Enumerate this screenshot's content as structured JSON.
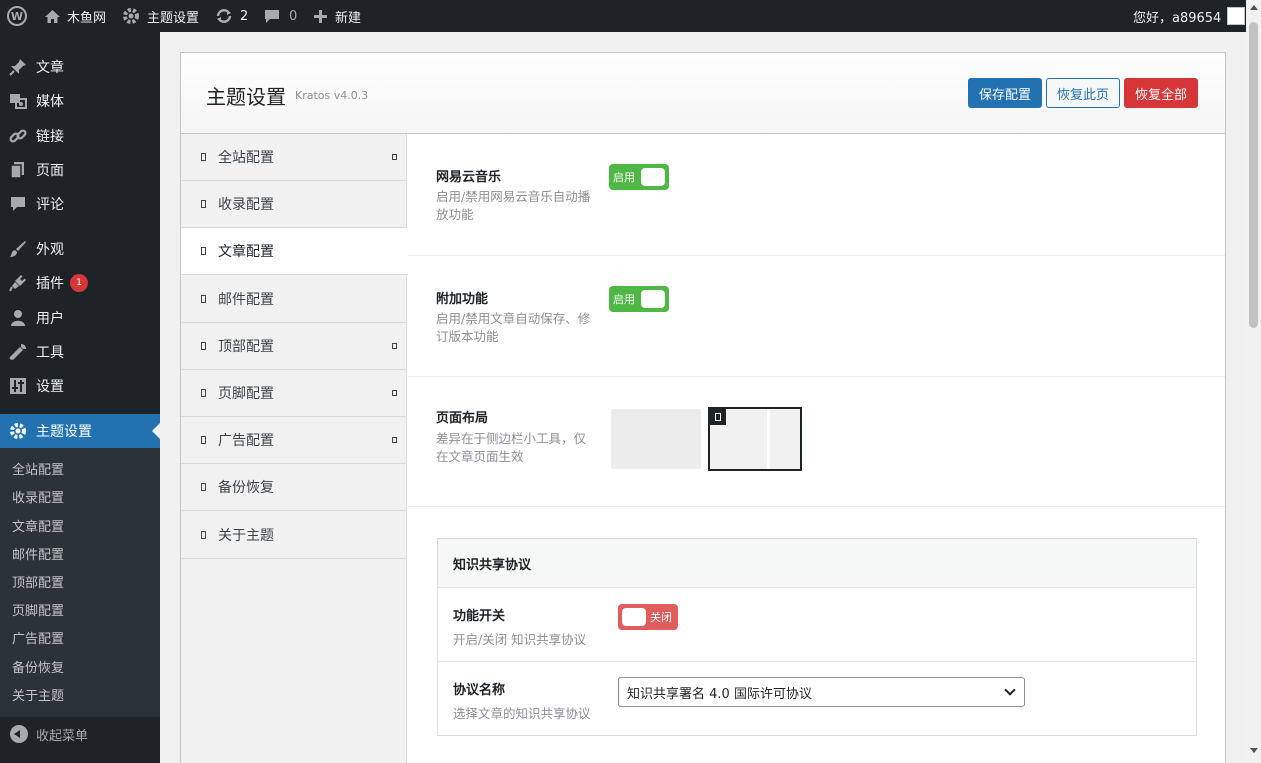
{
  "admin_bar": {
    "site_name": "木鱼网",
    "theme_settings": "主题设置",
    "updates_count": "2",
    "comments_count": "0",
    "new_label": "新建",
    "greeting": "您好，a89654"
  },
  "admin_menu": {
    "items": [
      {
        "label": "文章",
        "icon": "pin-icon"
      },
      {
        "label": "媒体",
        "icon": "media-icon"
      },
      {
        "label": "链接",
        "icon": "link-icon"
      },
      {
        "label": "页面",
        "icon": "page-icon"
      },
      {
        "label": "评论",
        "icon": "comment-icon"
      },
      {
        "label": "外观",
        "icon": "brush-icon"
      },
      {
        "label": "插件",
        "icon": "plugin-icon",
        "badge": "1"
      },
      {
        "label": "用户",
        "icon": "user-icon"
      },
      {
        "label": "工具",
        "icon": "wrench-icon"
      },
      {
        "label": "设置",
        "icon": "settings-icon"
      },
      {
        "label": "主题设置",
        "icon": "gear-icon"
      }
    ],
    "submenu": [
      "全站配置",
      "收录配置",
      "文章配置",
      "邮件配置",
      "顶部配置",
      "页脚配置",
      "广告配置",
      "备份恢复",
      "关于主题"
    ],
    "collapse_label": "收起菜单"
  },
  "panel": {
    "title": "主题设置",
    "version": "Kratos v4.0.3",
    "buttons": {
      "save": "保存配置",
      "restore_page": "恢复此页",
      "restore_all": "恢复全部"
    }
  },
  "panel_nav": {
    "items": [
      "全站配置",
      "收录配置",
      "文章配置",
      "邮件配置",
      "顶部配置",
      "页脚配置",
      "广告配置",
      "备份恢复",
      "关于主题"
    ],
    "active": "文章配置"
  },
  "fields": {
    "music": {
      "title": "网易云音乐",
      "desc": "启用/禁用网易云音乐自动播放功能",
      "toggle": "启用"
    },
    "extra": {
      "title": "附加功能",
      "desc": "启用/禁用文章自动保存、修订版本功能",
      "toggle": "启用"
    },
    "layout": {
      "title": "页面布局",
      "desc": "差异在于侧边栏小工具，仅在文章页面生效"
    },
    "cc": {
      "heading": "知识共享协议",
      "switch_title": "功能开关",
      "switch_desc": "开启/关闭 知识共享协议",
      "switch_toggle": "关闭",
      "name_title": "协议名称",
      "name_desc": "选择文章的知识共享协议",
      "name_value": "知识共享署名 4.0 国际许可协议"
    }
  },
  "colors": {
    "primary": "#2271b1",
    "danger": "#d63638",
    "toggle_on": "#4fb845",
    "toggle_off": "#e05d5d",
    "admin_dark": "#1d2327"
  }
}
